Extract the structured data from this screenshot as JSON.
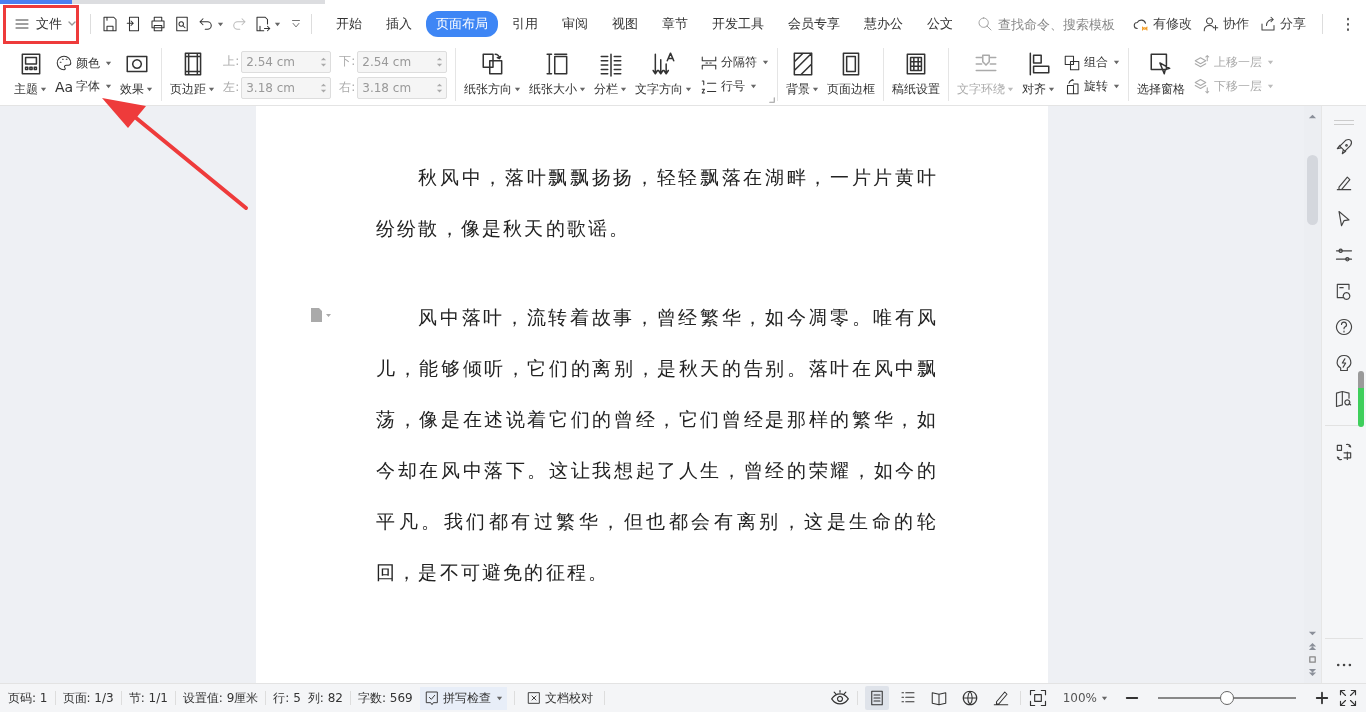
{
  "file_menu": {
    "label": "文件"
  },
  "quick_access": [
    {
      "disabled": false
    },
    {
      "disabled": false
    },
    {
      "disabled": false
    },
    {
      "disabled": false
    },
    {
      "disabled": false
    },
    {
      "disabled": true
    },
    {
      "disabled": false
    }
  ],
  "menu_tabs": [
    {
      "label": "开始",
      "selected": false
    },
    {
      "label": "插入",
      "selected": false
    },
    {
      "label": "页面布局",
      "selected": true
    },
    {
      "label": "引用",
      "selected": false
    },
    {
      "label": "审阅",
      "selected": false
    },
    {
      "label": "视图",
      "selected": false
    },
    {
      "label": "章节",
      "selected": false
    },
    {
      "label": "开发工具",
      "selected": false
    },
    {
      "label": "会员专享",
      "selected": false
    },
    {
      "label": "慧办公",
      "selected": false
    },
    {
      "label": "公文",
      "selected": false
    }
  ],
  "search": {
    "placeholder": "查找命令、搜索模板"
  },
  "header_actions": [
    {
      "label": "有修改"
    },
    {
      "label": "协作"
    },
    {
      "label": "分享"
    }
  ],
  "ribbon_groups": [
    {
      "items": [
        {
          "kind": "large",
          "label": "主题",
          "dropdown": true,
          "disabled": false
        },
        {
          "kind": "stack",
          "items": [
            {
              "label": "颜色",
              "dropdown": true,
              "disabled": false
            },
            {
              "label": "字体",
              "prefix": "Aa",
              "dropdown": true,
              "disabled": false
            }
          ]
        },
        {
          "kind": "large",
          "label": "效果",
          "dropdown": true,
          "disabled": false
        }
      ]
    },
    {
      "items": [
        {
          "kind": "large",
          "label": "页边距",
          "dropdown": true,
          "disabled": false
        },
        {
          "kind": "fields",
          "items": [
            {
              "label": "上:",
              "value": "2.54 cm",
              "disabled": true
            },
            {
              "label": "左:",
              "value": "3.18 cm",
              "disabled": true
            }
          ]
        },
        {
          "kind": "fields",
          "items": [
            {
              "label": "下:",
              "value": "2.54 cm",
              "disabled": true
            },
            {
              "label": "右:",
              "value": "3.18 cm",
              "disabled": true
            }
          ]
        }
      ]
    },
    {
      "items": [
        {
          "kind": "large",
          "label": "纸张方向",
          "dropdown": true,
          "disabled": false
        },
        {
          "kind": "large",
          "label": "纸张大小",
          "dropdown": true,
          "disabled": false
        },
        {
          "kind": "large",
          "label": "分栏",
          "dropdown": true,
          "disabled": false
        },
        {
          "kind": "large",
          "label": "文字方向",
          "dropdown": true,
          "disabled": false
        },
        {
          "kind": "stack",
          "items": [
            {
              "label": "分隔符",
              "dropdown": true,
              "disabled": false
            },
            {
              "label": "行号",
              "dropdown": true,
              "disabled": false
            }
          ]
        }
      ]
    },
    {
      "items": [
        {
          "kind": "large",
          "label": "背景",
          "dropdown": true,
          "disabled": false
        },
        {
          "kind": "large",
          "label": "页面边框",
          "dropdown": false,
          "disabled": false
        }
      ]
    },
    {
      "items": [
        {
          "kind": "large",
          "label": "稿纸设置",
          "dropdown": false,
          "disabled": false
        }
      ]
    },
    {
      "items": [
        {
          "kind": "large",
          "label": "文字环绕",
          "dropdown": true,
          "disabled": true
        },
        {
          "kind": "large",
          "label": "对齐",
          "dropdown": true,
          "disabled": false
        },
        {
          "kind": "stack",
          "items": [
            {
              "label": "组合",
              "dropdown": true,
              "disabled": false
            },
            {
              "label": "旋转",
              "dropdown": true,
              "disabled": false
            }
          ]
        }
      ]
    },
    {
      "items": [
        {
          "kind": "large",
          "label": "选择窗格",
          "dropdown": false,
          "disabled": false
        },
        {
          "kind": "stack",
          "items": [
            {
              "label": "上移一层",
              "dropdown": true,
              "disabled": true
            },
            {
              "label": "下移一层",
              "dropdown": true,
              "disabled": true
            }
          ]
        }
      ]
    }
  ],
  "document": {
    "paragraphs": [
      "秋风中，落叶飘飘扬扬，轻轻飘落在湖畔，一片片黄叶纷纷散，像是秋天的歌谣。",
      "风中落叶，流转着故事，曾经繁华，如今凋零。唯有风儿，能够倾听，它们的离别，是秋天的告别。落叶在风中飘荡，像是在述说着它们的曾经，它们曾经是那样的繁华，如今却在风中落下。这让我想起了人生，曾经的荣耀，如今的平凡。我们都有过繁华，但也都会有离别，这是生命的轮回，是不可避免的征程。"
    ]
  },
  "status_bar": {
    "items": [
      {
        "label": "页码: 1",
        "divider": true
      },
      {
        "label": "页面: 1/3",
        "divider": true
      },
      {
        "label": "节: 1/1",
        "divider": true
      },
      {
        "label": "设置值: 9厘米",
        "divider": true
      },
      {
        "label": "行: 5",
        "divider": false
      },
      {
        "label": "列: 82",
        "divider": true
      },
      {
        "label": "字数: 569",
        "divider": false
      }
    ],
    "spell_check": {
      "label": "拼写检查"
    },
    "proofread": {
      "label": "文档校对"
    },
    "view_modes": [
      {
        "selected": true
      },
      {
        "selected": false
      },
      {
        "selected": false
      },
      {
        "selected": false
      },
      {
        "selected": false
      }
    ],
    "zoom": {
      "value": "100%",
      "level": 0.5
    }
  }
}
